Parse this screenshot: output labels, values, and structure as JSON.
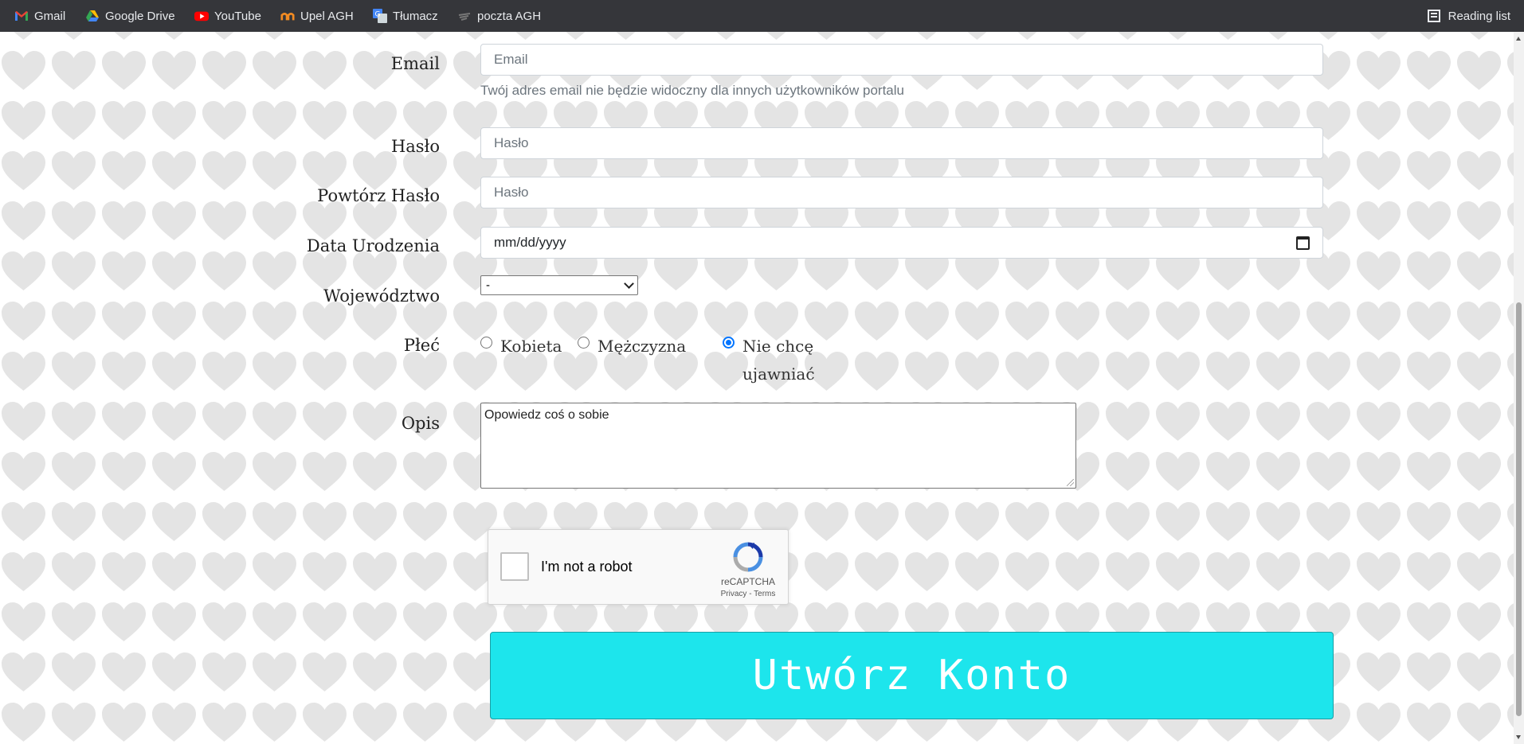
{
  "bookmarks": [
    {
      "label": "Gmail",
      "icon": "gmail-icon"
    },
    {
      "label": "Google Drive",
      "icon": "google-drive-icon"
    },
    {
      "label": "YouTube",
      "icon": "youtube-icon"
    },
    {
      "label": "Upel AGH",
      "icon": "upel-icon"
    },
    {
      "label": "Tłumacz",
      "icon": "translate-icon"
    },
    {
      "label": "poczta AGH",
      "icon": "mail-icon"
    }
  ],
  "reading_list": {
    "label": "Reading list",
    "icon": "reading-list-icon"
  },
  "form": {
    "email": {
      "label": "Email",
      "placeholder": "Email",
      "help": "Twój adres email nie będzie widoczny dla innych użytkowników portalu"
    },
    "password": {
      "label": "Hasło",
      "placeholder": "Hasło"
    },
    "password_repeat": {
      "label": "Powtórz Hasło",
      "placeholder": "Hasło"
    },
    "birth_date": {
      "label": "Data Urodzenia",
      "value": "mm/dd/yyyy"
    },
    "voivodeship": {
      "label": "Województwo",
      "selected": "-"
    },
    "gender": {
      "label": "Płeć",
      "options": [
        {
          "label": "Kobieta",
          "checked": false
        },
        {
          "label": "Mężczyzna",
          "checked": false
        },
        {
          "label": "Nie chcę ujawniać",
          "line1": "Nie chcę",
          "line2": "ujawniać",
          "checked": true
        }
      ]
    },
    "description": {
      "label": "Opis",
      "value": "Opowiedz coś o sobie"
    },
    "captcha": {
      "label": "I'm not a robot",
      "brand": "reCAPTCHA",
      "privacy": "Privacy",
      "separator": "-",
      "terms": "Terms"
    },
    "submit": "Utwórz Konto"
  },
  "colors": {
    "bookmarks_bar": "#35363a",
    "submit_bg": "#1de5ec",
    "radio_accent": "#0075ff",
    "heart_pattern": "#e4e4e4"
  }
}
